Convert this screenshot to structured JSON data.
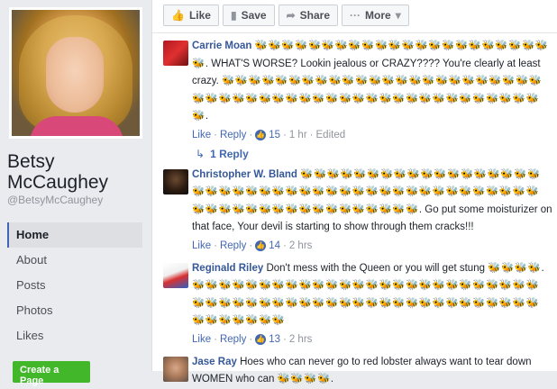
{
  "sidebar": {
    "name_line1": "Betsy",
    "name_line2": "McCaughey",
    "handle": "@BetsyMcCaughey",
    "nav": [
      {
        "label": "Home",
        "active": true
      },
      {
        "label": "About"
      },
      {
        "label": "Posts"
      },
      {
        "label": "Photos"
      },
      {
        "label": "Likes"
      }
    ],
    "create_page": "Create a Page"
  },
  "actionbar": {
    "like": "Like",
    "save": "Save",
    "share": "Share",
    "more": "More",
    "like_icon": "thumbs-up-icon",
    "save_icon": "bookmark-icon",
    "share_icon": "share-arrow-icon",
    "more_icon": "ellipsis-icon"
  },
  "comments": [
    {
      "author": "Carrie Moan",
      "bees_lead": "🐝🐝🐝🐝🐝🐝🐝🐝🐝🐝🐝🐝🐝🐝🐝🐝🐝🐝🐝🐝🐝🐝🐝",
      "text": ". WHAT'S WORSE? Lookin jealous or CRAZY???? You're clearly at least crazy. ",
      "bees_tail": "🐝🐝🐝🐝🐝🐝🐝🐝🐝🐝🐝🐝🐝🐝🐝🐝🐝🐝🐝🐝🐝🐝🐝🐝🐝🐝🐝🐝🐝🐝🐝🐝🐝🐝🐝🐝🐝🐝🐝🐝🐝🐝🐝🐝🐝🐝🐝🐝🐝🐝🐝.",
      "like": "Like",
      "reply": "Reply",
      "likes": "15",
      "time": "1 hr",
      "edited": "Edited",
      "replies": "1 Reply"
    },
    {
      "author": "Christopher W. Bland",
      "bees_lead": "🐝🐝🐝🐝🐝🐝🐝🐝🐝🐝🐝🐝🐝🐝🐝🐝🐝🐝🐝🐝🐝🐝🐝🐝🐝🐝🐝🐝🐝🐝🐝🐝🐝🐝🐝🐝🐝🐝🐝🐝🐝🐝🐝🐝🐝🐝🐝🐝🐝🐝🐝🐝🐝🐝🐝🐝🐝🐝🐝🐝🐝",
      "text": ". Go put some moisturizer on that face, Your devil is starting to show through them cracks!!!",
      "like": "Like",
      "reply": "Reply",
      "likes": "14",
      "time": "2 hrs"
    },
    {
      "author": "Reginald Riley",
      "text": "Don't mess with the Queen or you will get stung ",
      "bees_tail": "🐝🐝🐝🐝.🐝🐝🐝🐝🐝🐝🐝🐝🐝🐝🐝🐝🐝🐝🐝🐝🐝🐝🐝🐝🐝🐝🐝🐝🐝🐝🐝🐝🐝🐝🐝🐝🐝🐝🐝🐝🐝🐝🐝🐝🐝🐝🐝🐝🐝🐝🐝🐝🐝🐝🐝🐝🐝🐝🐝🐝🐝🐝🐝",
      "like": "Like",
      "reply": "Reply",
      "likes": "13",
      "time": "2 hrs"
    },
    {
      "author": "Jase Ray",
      "text": "Hoes who can never go to red lobster always want to tear down WOMEN who can ",
      "bees_tail": "🐝🐝🐝🐝."
    }
  ]
}
